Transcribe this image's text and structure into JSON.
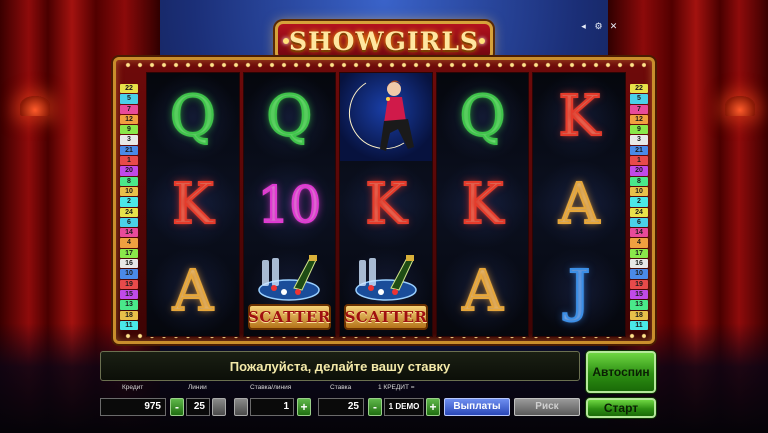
{
  "game": {
    "title": "SHOWGIRLS"
  },
  "window_controls": [
    {
      "name": "sound-icon",
      "glyph": "◂"
    },
    {
      "name": "settings-icon",
      "glyph": "⚙"
    },
    {
      "name": "close-icon",
      "glyph": "✕"
    }
  ],
  "paylines": {
    "left": [
      "22",
      "5",
      "7",
      "12",
      "9",
      "3",
      "21",
      "1",
      "20",
      "8",
      "10",
      "2",
      "24",
      "6",
      "14",
      "4",
      "17",
      "16",
      "10",
      "19",
      "15",
      "13",
      "18",
      "11"
    ],
    "right": [
      "22",
      "5",
      "7",
      "12",
      "9",
      "3",
      "21",
      "1",
      "20",
      "8",
      "10",
      "2",
      "24",
      "6",
      "14",
      "4",
      "17",
      "16",
      "10",
      "19",
      "15",
      "13",
      "18",
      "11"
    ],
    "colors": [
      "#e8e24a",
      "#4ad1e8",
      "#e84a9a",
      "#f0a040",
      "#8ae84a",
      "#e8e8e8",
      "#4a8ae8",
      "#e84a4a",
      "#c04ae8",
      "#4ae88a",
      "#e8c04a",
      "#4ae8e8"
    ]
  },
  "reels": [
    [
      "Q",
      "K",
      "A"
    ],
    [
      "Q",
      "10",
      "SCATTER"
    ],
    [
      "SHOWGIRL",
      "K",
      "SCATTER"
    ],
    [
      "Q",
      "K",
      "A"
    ],
    [
      "K",
      "A",
      "J"
    ]
  ],
  "scatter_label": "SCATTER",
  "message": "Пожалуйста, делайте вашу ставку",
  "labels": {
    "credit": "Кредит",
    "lines": "Линии",
    "bet_per_line": "Ставка/линия",
    "bet": "Ставка",
    "one_credit": "1 КРЕДИТ ="
  },
  "values": {
    "credit": "975",
    "lines": "25",
    "bet_per_line": "1",
    "bet": "25",
    "denomination": "1 DEMO"
  },
  "buttons": {
    "minus": "-",
    "plus": "+",
    "paytable": "Выплаты",
    "gamble": "Риск",
    "autospin": "Автоспин",
    "start": "Старт"
  }
}
